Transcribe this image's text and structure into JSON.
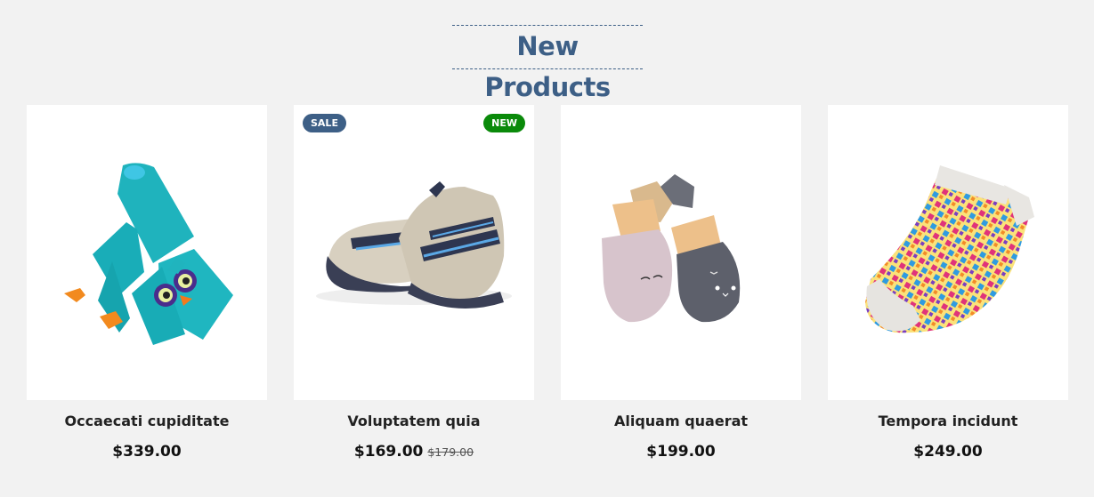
{
  "section": {
    "title": "New Products"
  },
  "products": [
    {
      "name": "Occaecati cupiditate",
      "price": "$339.00",
      "image_icon": "owl-scarf-image"
    },
    {
      "name": "Voluptatem quia",
      "price": "$169.00",
      "old_price": "$179.00",
      "badges": {
        "sale": "SALE",
        "new": "NEW"
      },
      "image_icon": "baby-shoes-image"
    },
    {
      "name": "Aliquam quaerat",
      "price": "$199.00",
      "image_icon": "cat-mittens-image"
    },
    {
      "name": "Tempora incidunt",
      "price": "$249.00",
      "image_icon": "patterned-sock-image"
    }
  ],
  "colors": {
    "accent": "#3d5f86",
    "new_badge": "#0a8a0a",
    "background": "#f2f2f2"
  }
}
